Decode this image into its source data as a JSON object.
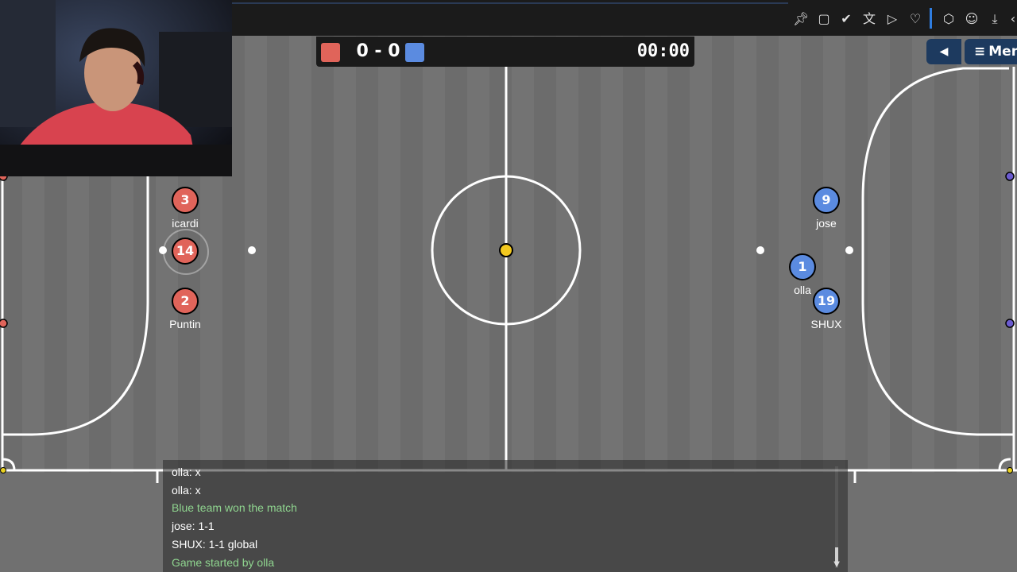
{
  "scoreboard": {
    "score": "0 - 0",
    "time": "00:00",
    "red_color": "#e0645a",
    "blue_color": "#5b8be0"
  },
  "menu": {
    "sound_icon": "speaker-icon",
    "label": "Men"
  },
  "browser_toolbar_icons": [
    "pin-icon",
    "screenshot-icon",
    "pocket-icon",
    "translate-icon",
    "send-icon",
    "heart-icon",
    "extensions-icon",
    "account-icon",
    "download-icon",
    "back-icon"
  ],
  "players": {
    "red": [
      {
        "number": "3",
        "name": "icardi"
      },
      {
        "number": "14",
        "name": ""
      },
      {
        "number": "2",
        "name": "Puntin"
      }
    ],
    "blue": [
      {
        "number": "9",
        "name": "jose"
      },
      {
        "number": "1",
        "name": "olla"
      },
      {
        "number": "19",
        "name": "SHUX"
      }
    ]
  },
  "chat": {
    "messages": [
      {
        "text": "olla: x",
        "system": false
      },
      {
        "text": "olla: x",
        "system": false
      },
      {
        "text": "Blue team won the match",
        "system": true
      },
      {
        "text": "jose: 1-1",
        "system": false
      },
      {
        "text": "SHUX: 1-1 global",
        "system": false
      },
      {
        "text": "Game started by olla",
        "system": true
      }
    ]
  }
}
